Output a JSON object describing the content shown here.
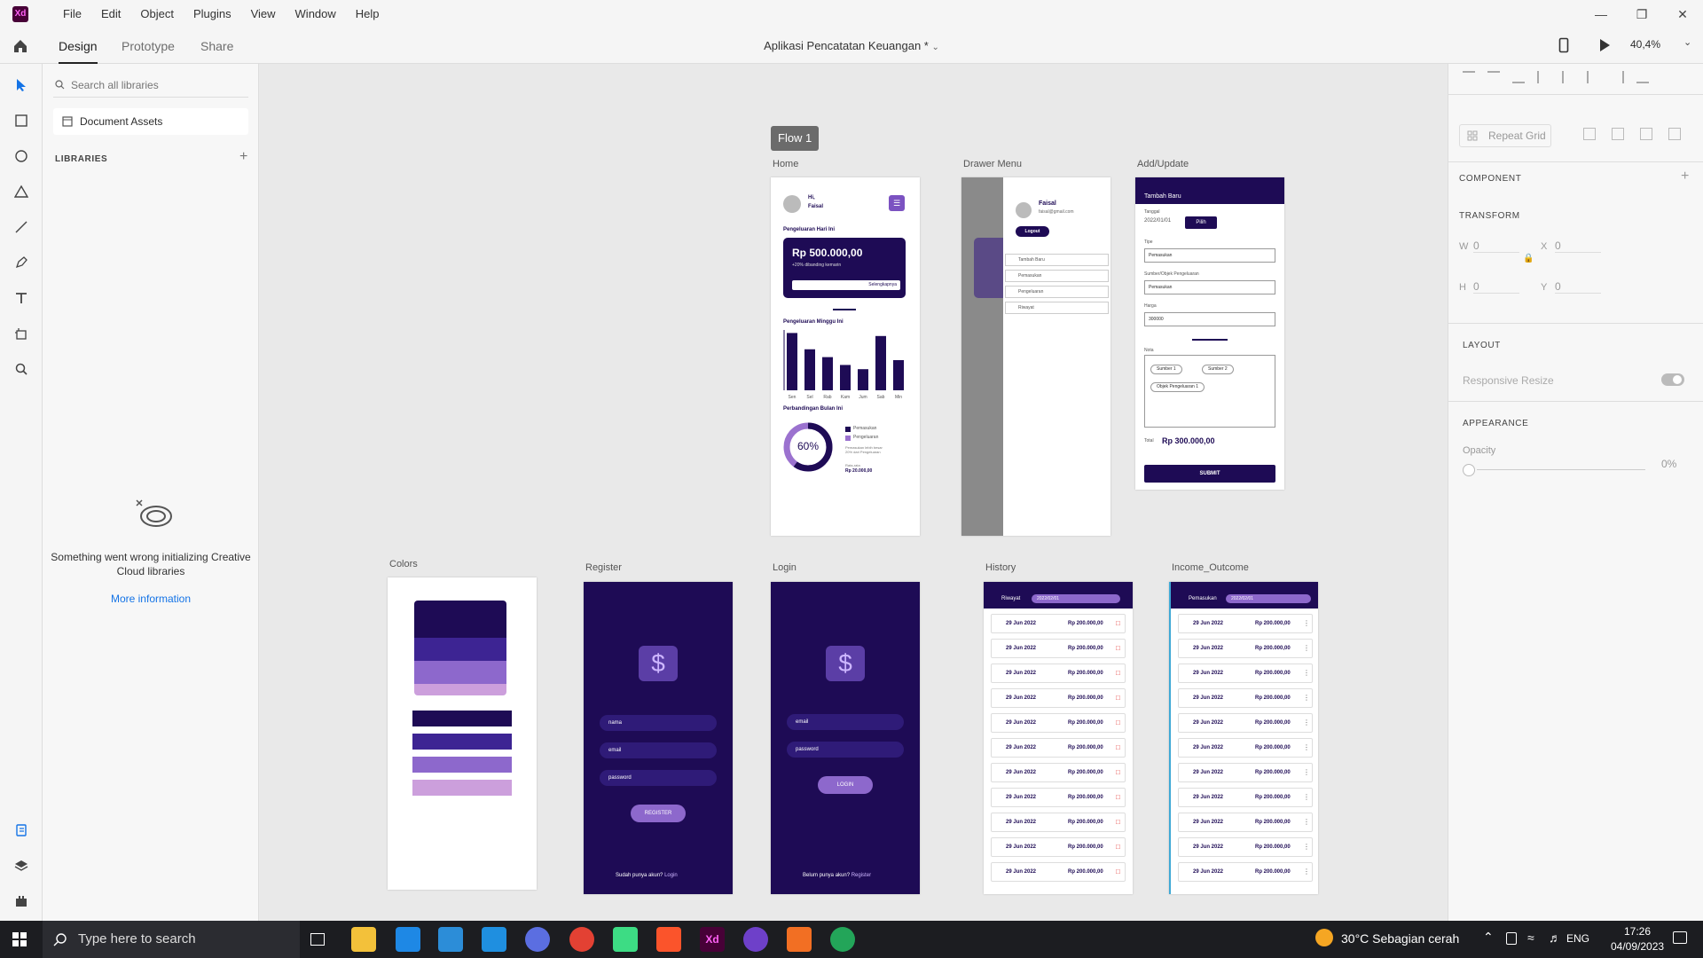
{
  "app": {
    "logo_text": "Xd",
    "menus": [
      "File",
      "Edit",
      "Object",
      "Plugins",
      "View",
      "Window",
      "Help"
    ],
    "tabs": [
      "Design",
      "Prototype",
      "Share"
    ],
    "doc_title": "Aplikasi Pencatatan Keuangan *",
    "zoom": "40,4%",
    "accent": "#1e0b55"
  },
  "assets": {
    "search_placeholder": "Search all libraries",
    "document_assets": "Document Assets",
    "libraries_heading": "LIBRARIES",
    "error_text": "Something went wrong initializing Creative Cloud libraries",
    "more_info": "More information"
  },
  "right": {
    "repeat_grid": "Repeat Grid",
    "component": "COMPONENT",
    "transform": "TRANSFORM",
    "w_label": "W",
    "w_value": "0",
    "x_label": "X",
    "x_value": "0",
    "h_label": "H",
    "h_value": "0",
    "y_label": "Y",
    "y_value": "0",
    "layout": "LAYOUT",
    "responsive": "Responsive Resize",
    "appearance": "APPEARANCE",
    "opacity_label": "Opacity",
    "opacity_value": "0%"
  },
  "canvas": {
    "flow": "Flow 1",
    "artboards": {
      "home": "Home",
      "drawer": "Drawer Menu",
      "add": "Add/Update",
      "colors": "Colors",
      "register": "Register",
      "login": "Login",
      "history": "History",
      "income": "Income_Outcome"
    },
    "home": {
      "greeting": "Hi,",
      "name": "Faisal",
      "today_heading": "Pengeluaran Hari Ini",
      "amount": "Rp 500.000,00",
      "compare": "+20% dibanding kemarin",
      "more": "Selengkapnya",
      "week_heading": "Pengeluaran Minggu Ini",
      "days": [
        "Sen",
        "Sel",
        "Rab",
        "Kam",
        "Jum",
        "Sab",
        "Min"
      ],
      "week_values": [
        95,
        68,
        55,
        42,
        35,
        90,
        50
      ],
      "month_heading": "Perbandingan Bulan Ini",
      "percent": "60%",
      "legend_in": "Pemasukan",
      "legend_out": "Pengeluaran",
      "note": "Pemasukan lebih besar 20% dari Pengeluaran",
      "avg_label": "Rata-rata",
      "avg_value": "Rp 20.000,00"
    },
    "drawer": {
      "name": "Faisal",
      "email": "faisal@gmail.com",
      "logout": "Logout",
      "items": [
        "Tambah Baru",
        "Pemasukan",
        "Pengeluaran",
        "Riwayat"
      ]
    },
    "add": {
      "header": "Tambah Baru",
      "date_label": "Tanggal",
      "date_value": "2022/01/01",
      "pick": "Pilih",
      "type_label": "Tipe",
      "type_value": "Pemasukan",
      "source_label": "Sumber/Objek Pengeluaran",
      "source_value": "Pemasukan",
      "price_label": "Harga",
      "price_value": "300000",
      "list_label": "Nota",
      "chips": [
        "Sumber 1",
        "Sumber 2",
        "Objek Pengeluaran 1"
      ],
      "total_label": "Total",
      "total_value": "Rp 300.000,00",
      "submit": "SUBMIT"
    },
    "register": {
      "fields": [
        "nama",
        "email",
        "password"
      ],
      "button": "REGISTER",
      "footer": "Sudah punya akun?",
      "footer_link": "Login"
    },
    "login": {
      "fields": [
        "email",
        "password"
      ],
      "button": "LOGIN",
      "footer": "Belum punya akun?",
      "footer_link": "Register"
    },
    "history": {
      "title": "Riwayat",
      "date_filter": "2022/02/01",
      "row_date": "29 Jun 2022",
      "row_amount": "Rp 200.000,00"
    },
    "income": {
      "title": "Pemasukan",
      "date_filter": "2022/02/01",
      "row_date": "29 Jun 2022",
      "row_amount": "Rp 200.000,00"
    }
  },
  "taskbar": {
    "search": "Type here to search",
    "weather": "30°C  Sebagian cerah",
    "lang": "ENG",
    "time": "17:26",
    "date": "04/09/2023"
  }
}
